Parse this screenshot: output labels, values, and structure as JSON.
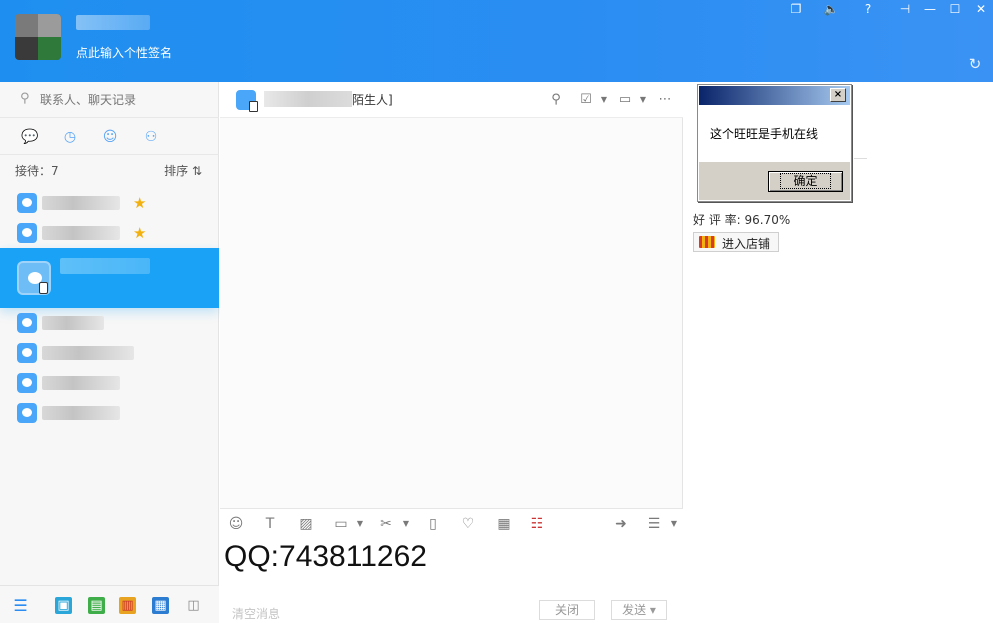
{
  "profile": {
    "signature": "点此输入个性签名"
  },
  "window_controls": [
    "restore-icon",
    "speaker-icon",
    "help-icon",
    "pin-icon",
    "minimize-icon",
    "maximize-icon",
    "close-icon"
  ],
  "search": {
    "placeholder": "联系人、聊天记录"
  },
  "left_tabs": [
    "chat-tab-icon",
    "recent-tab-icon",
    "contacts-tab-icon",
    "groups-tab-icon"
  ],
  "reception": {
    "label": "接待：7",
    "sort_label": "排序 ⇅"
  },
  "chat": {
    "title_suffix": "陌生人]",
    "message_text": "QQ:743811262",
    "clear_label": "清空消息",
    "close_label": "关闭",
    "send_label": "发送 ▾"
  },
  "right_panel": {
    "rating": "好 评 率: 96.70%",
    "shop_button": "进入店铺"
  },
  "dialog": {
    "message": "这个旺旺是手机在线",
    "ok_label": "确定",
    "close_symbol": "×"
  },
  "colors": {
    "topbar": "#2b8df2",
    "selected_row": "#1aa3f6",
    "star": "#f2b10e"
  }
}
